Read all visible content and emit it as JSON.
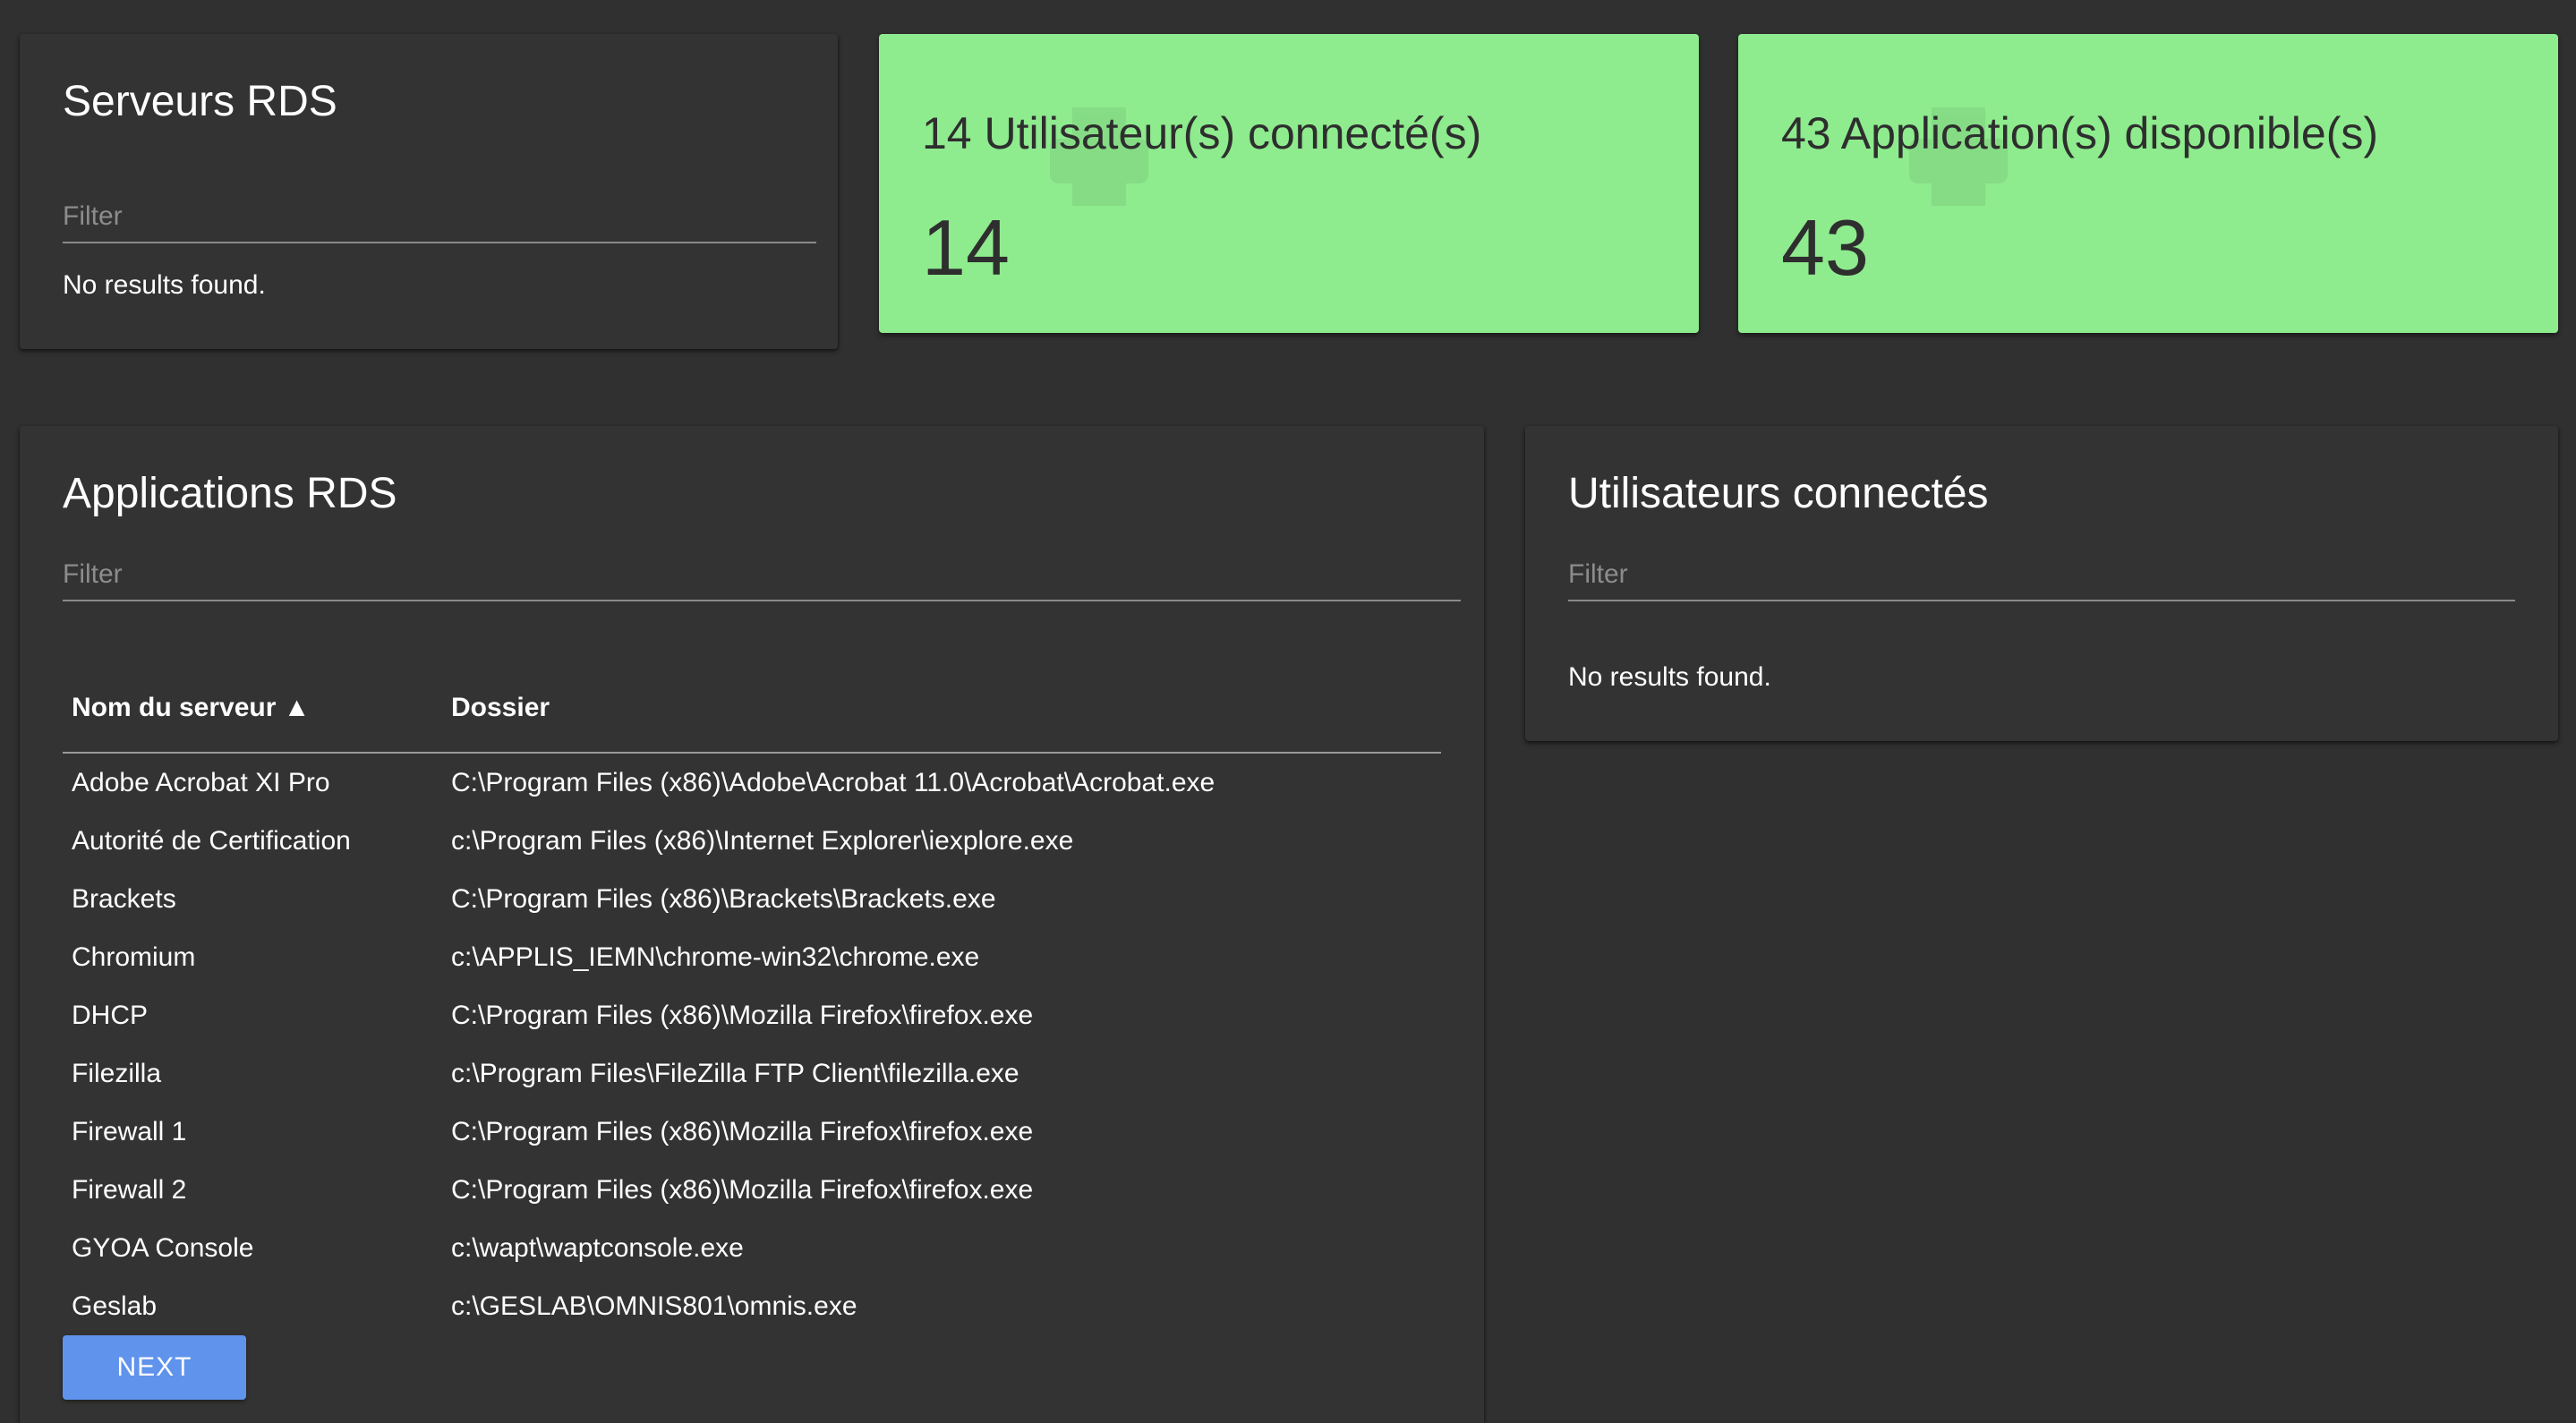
{
  "servers_card": {
    "title": "Serveurs RDS",
    "filter_placeholder": "Filter",
    "filter_value": "",
    "empty_message": "No results found."
  },
  "users_stat": {
    "title": "14 Utilisateur(s) connecté(s)",
    "value": "14",
    "icon": "printer-icon",
    "color": "#8eeb8e"
  },
  "apps_stat": {
    "title": "43 Application(s) disponible(s)",
    "value": "43",
    "icon": "printer-icon",
    "color": "#8eeb8e"
  },
  "apps_card": {
    "title": "Applications RDS",
    "filter_placeholder": "Filter",
    "filter_value": "",
    "columns": [
      "Nom du serveur ▲",
      "Dossier"
    ],
    "rows": [
      [
        "Adobe Acrobat XI Pro",
        "C:\\Program Files (x86)\\Adobe\\Acrobat 11.0\\Acrobat\\Acrobat.exe"
      ],
      [
        "Autorité de Certification",
        "c:\\Program Files (x86)\\Internet Explorer\\iexplore.exe"
      ],
      [
        "Brackets",
        "C:\\Program Files (x86)\\Brackets\\Brackets.exe"
      ],
      [
        "Chromium",
        "c:\\APPLIS_IEMN\\chrome-win32\\chrome.exe"
      ],
      [
        "DHCP",
        "C:\\Program Files (x86)\\Mozilla Firefox\\firefox.exe"
      ],
      [
        "Filezilla",
        "c:\\Program Files\\FileZilla FTP Client\\filezilla.exe"
      ],
      [
        "Firewall 1",
        "C:\\Program Files (x86)\\Mozilla Firefox\\firefox.exe"
      ],
      [
        "Firewall 2",
        "C:\\Program Files (x86)\\Mozilla Firefox\\firefox.exe"
      ],
      [
        "GYOA Console",
        "c:\\wapt\\waptconsole.exe"
      ],
      [
        "Geslab",
        "c:\\GESLAB\\OMNIS801\\omnis.exe"
      ]
    ],
    "next_label": "NEXT",
    "accent_color": "#5f93ec"
  },
  "users_card": {
    "title": "Utilisateurs connectés",
    "filter_placeholder": "Filter",
    "filter_value": "",
    "empty_message": "No results found."
  }
}
